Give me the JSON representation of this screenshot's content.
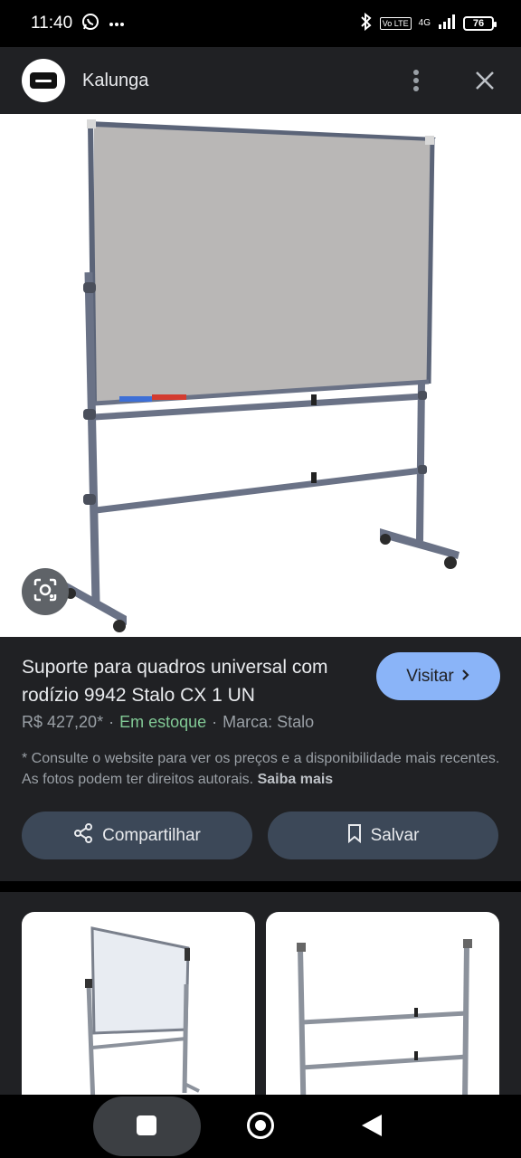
{
  "status_bar": {
    "time": "11:40",
    "left_icons": [
      "whatsapp-icon",
      "more-dots-icon"
    ],
    "volte": "Vo LTE",
    "network": "4G",
    "battery": "76"
  },
  "header": {
    "site_name": "Kalunga",
    "icons": [
      "site-logo",
      "more-vert-icon",
      "close-icon"
    ]
  },
  "product": {
    "title": "Suporte para quadros universal com rodízio 9942 Stalo CX 1 UN",
    "visit_label": "Visitar",
    "price": "R$ 427,20*",
    "stock": "Em estoque",
    "brand": "Marca: Stalo",
    "separator": "·",
    "disclaimer": "* Consulte o website para ver os preços e a disponibilidade mais recentes. As fotos podem ter direitos autorais.",
    "learn_more": "Saiba mais",
    "share_label": "Compartilhar",
    "save_label": "Salvar"
  },
  "colors": {
    "panel_bg": "#202124",
    "accent_button": "#8ab4f8",
    "in_stock": "#81c995",
    "action_button_bg": "#3c4858"
  }
}
